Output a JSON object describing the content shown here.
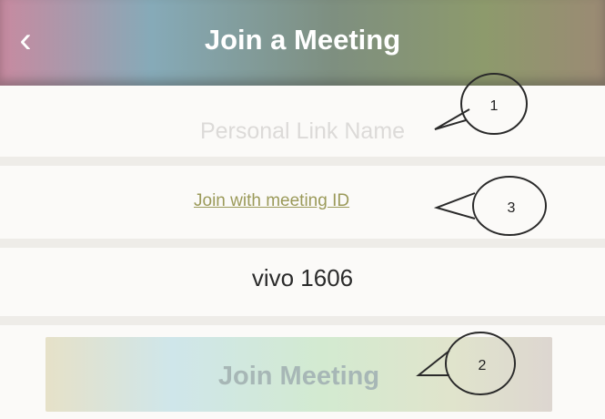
{
  "header": {
    "title": "Join a Meeting",
    "back_icon": "chevron-left-icon"
  },
  "form": {
    "personal_link_placeholder": "Personal Link Name",
    "join_with_id_link": "Join with meeting ID",
    "device_name": "vivo 1606",
    "join_button_label": "Join Meeting"
  },
  "annotations": {
    "callout_1": "1",
    "callout_2": "2",
    "callout_3": "3"
  }
}
